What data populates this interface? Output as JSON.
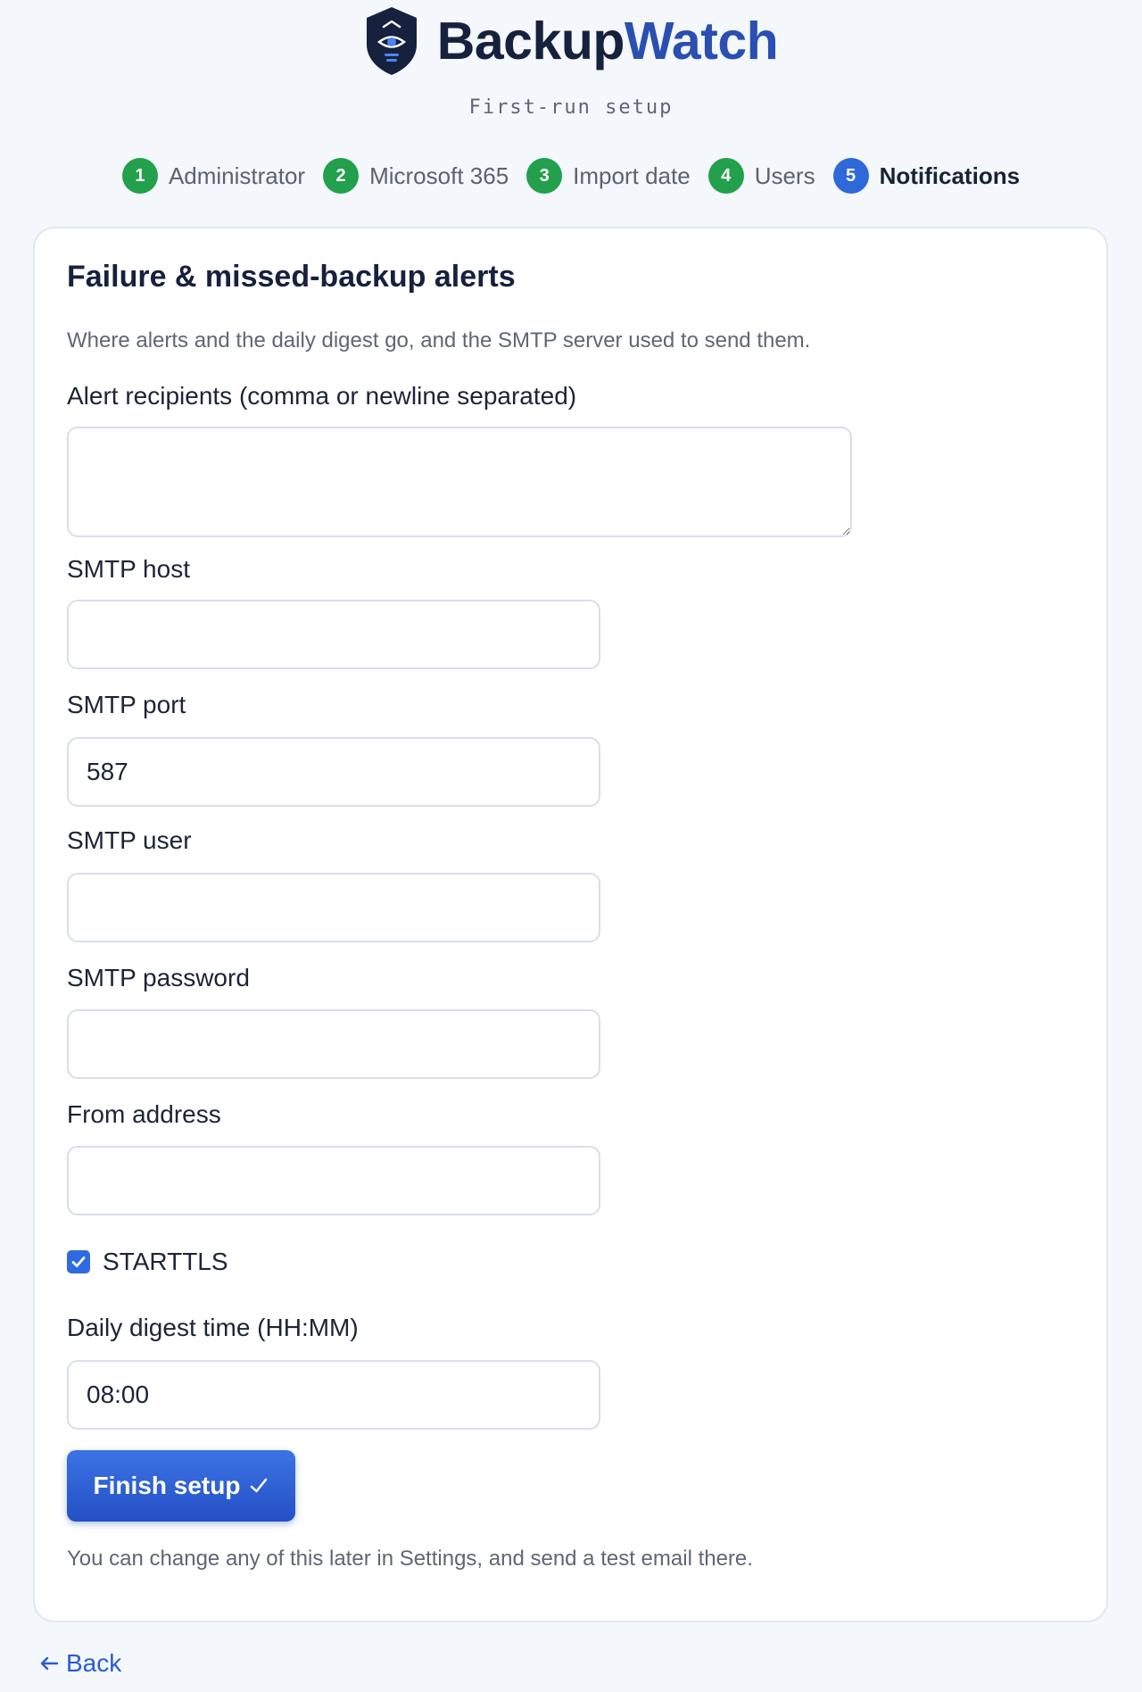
{
  "brand": {
    "name_part1": "Backup",
    "name_part2": "Watch",
    "subtitle": "First-run setup",
    "logo_icon": "shield-eye-icon"
  },
  "steps": [
    {
      "num": "1",
      "label": "Administrator",
      "state": "done"
    },
    {
      "num": "2",
      "label": "Microsoft 365",
      "state": "done"
    },
    {
      "num": "3",
      "label": "Import date",
      "state": "done"
    },
    {
      "num": "4",
      "label": "Users",
      "state": "done"
    },
    {
      "num": "5",
      "label": "Notifications",
      "state": "active"
    }
  ],
  "form": {
    "title": "Failure & missed-backup alerts",
    "description": "Where alerts and the daily digest go, and the SMTP server used to send them.",
    "recipients": {
      "label": "Alert recipients (comma or newline separated)",
      "value": ""
    },
    "smtp_host": {
      "label": "SMTP host",
      "value": ""
    },
    "smtp_port": {
      "label": "SMTP port",
      "value": "587"
    },
    "smtp_user": {
      "label": "SMTP user",
      "value": ""
    },
    "smtp_password": {
      "label": "SMTP password",
      "value": ""
    },
    "from_address": {
      "label": "From address",
      "value": ""
    },
    "starttls": {
      "label": "STARTTLS",
      "checked": true
    },
    "digest_time": {
      "label": "Daily digest time (HH:MM)",
      "value": "08:00"
    },
    "finish_label": "Finish setup",
    "finish_icon": "checkmark-icon",
    "help": "You can change any of this later in Settings, and send a test email there."
  },
  "nav": {
    "back_label": "Back",
    "back_icon": "arrow-left-icon"
  },
  "colors": {
    "accent": "#2f68d8",
    "done": "#22a04b",
    "brand_dark": "#16213e",
    "brand_blue": "#2a4fb1",
    "link": "#2a5bd6"
  }
}
